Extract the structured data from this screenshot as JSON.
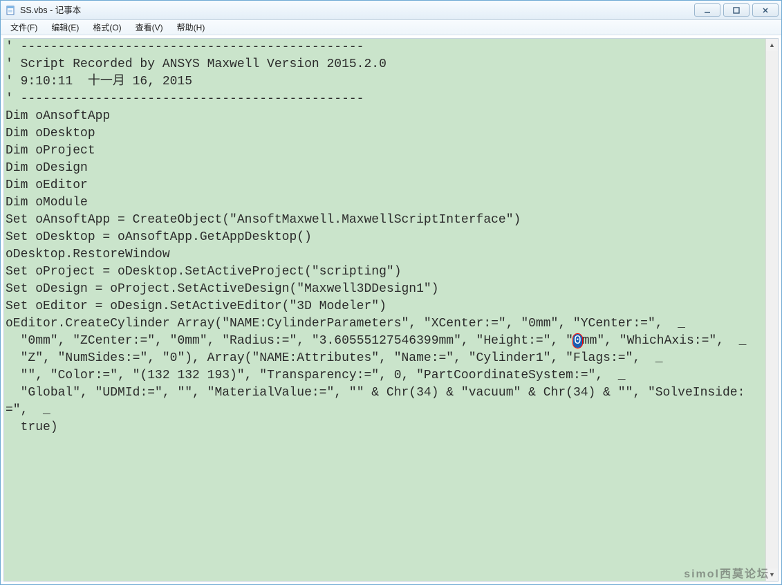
{
  "window": {
    "title": "SS.vbs - 记事本"
  },
  "menu": {
    "file": "文件(F)",
    "edit": "编辑(E)",
    "format": "格式(O)",
    "view": "查看(V)",
    "help": "帮助(H)"
  },
  "watermark": "simol西莫论坛",
  "editor": {
    "pre_selection": "' ----------------------------------------------\n' Script Recorded by ANSYS Maxwell Version 2015.2.0\n' 9:10:11  十一月 16, 2015\n' ----------------------------------------------\nDim oAnsoftApp\nDim oDesktop\nDim oProject\nDim oDesign\nDim oEditor\nDim oModule\nSet oAnsoftApp = CreateObject(\"AnsoftMaxwell.MaxwellScriptInterface\")\nSet oDesktop = oAnsoftApp.GetAppDesktop()\noDesktop.RestoreWindow\nSet oProject = oDesktop.SetActiveProject(\"scripting\")\nSet oDesign = oProject.SetActiveDesign(\"Maxwell3DDesign1\")\nSet oEditor = oDesign.SetActiveEditor(\"3D Modeler\")\noEditor.CreateCylinder Array(\"NAME:CylinderParameters\", \"XCenter:=\", \"0mm\", \"YCenter:=\",  _\n  \"0mm\", \"ZCenter:=\", \"0mm\", \"Radius:=\", \"3.60555127546399mm\", \"Height:=\", \"",
    "selection": "0",
    "post_selection": "mm\", \"WhichAxis:=\",  _\n  \"Z\", \"NumSides:=\", \"0\"), Array(\"NAME:Attributes\", \"Name:=\", \"Cylinder1\", \"Flags:=\",  _\n  \"\", \"Color:=\", \"(132 132 193)\", \"Transparency:=\", 0, \"PartCoordinateSystem:=\",  _\n  \"Global\", \"UDMId:=\", \"\", \"MaterialValue:=\", \"\" & Chr(34) & \"vacuum\" & Chr(34) & \"\", \"SolveInside:=\",  _\n  true)\n"
  }
}
